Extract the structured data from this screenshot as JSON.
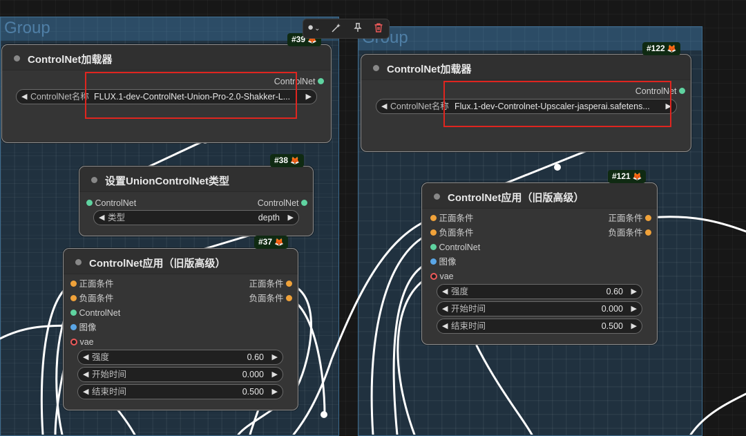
{
  "groups": [
    {
      "title": "Group"
    },
    {
      "title": "Group"
    }
  ],
  "toolbar": {
    "color_icon": "●",
    "chevron": "⌄",
    "bypass_icon": "wand-icon",
    "pin_icon": "pin-icon",
    "delete_icon": "trash-icon"
  },
  "nodes": {
    "n39": {
      "badge": "#39",
      "title": "ControlNet加载器",
      "output": "ControlNet",
      "widget_label": "ControlNet名称",
      "widget_value": "FLUX.1-dev-ControlNet-Union-Pro-2.0-Shakker-L..."
    },
    "n38": {
      "badge": "#38",
      "title": "设置UnionControlNet类型",
      "input": "ControlNet",
      "output": "ControlNet",
      "widget_label": "类型",
      "widget_value": "depth"
    },
    "n37": {
      "badge": "#37",
      "title": "ControlNet应用（旧版高级）",
      "inputs": [
        "正面条件",
        "负面条件",
        "ControlNet",
        "图像",
        "vae"
      ],
      "outputs": [
        "正面条件",
        "负面条件"
      ],
      "widgets": [
        {
          "label": "强度",
          "value": "0.60"
        },
        {
          "label": "开始时间",
          "value": "0.000"
        },
        {
          "label": "结束时间",
          "value": "0.500"
        }
      ]
    },
    "n122": {
      "badge": "#122",
      "title": "ControlNet加载器",
      "output": "ControlNet",
      "widget_label": "ControlNet名称",
      "widget_value": "Flux.1-dev-Controlnet-Upscaler-jasperai.safetens..."
    },
    "n121": {
      "badge": "#121",
      "title": "ControlNet应用（旧版高级）",
      "inputs": [
        "正面条件",
        "负面条件",
        "ControlNet",
        "图像",
        "vae"
      ],
      "outputs": [
        "正面条件",
        "负面条件"
      ],
      "widgets": [
        {
          "label": "强度",
          "value": "0.60"
        },
        {
          "label": "开始时间",
          "value": "0.000"
        },
        {
          "label": "结束时间",
          "value": "0.500"
        }
      ]
    }
  },
  "icons": {
    "fox": "🦊",
    "arrow_left": "◀",
    "arrow_right": "▶"
  },
  "colors": {
    "highlight": "#e0251f",
    "badge_bg": "#0f2a12",
    "group": "#305c80"
  }
}
